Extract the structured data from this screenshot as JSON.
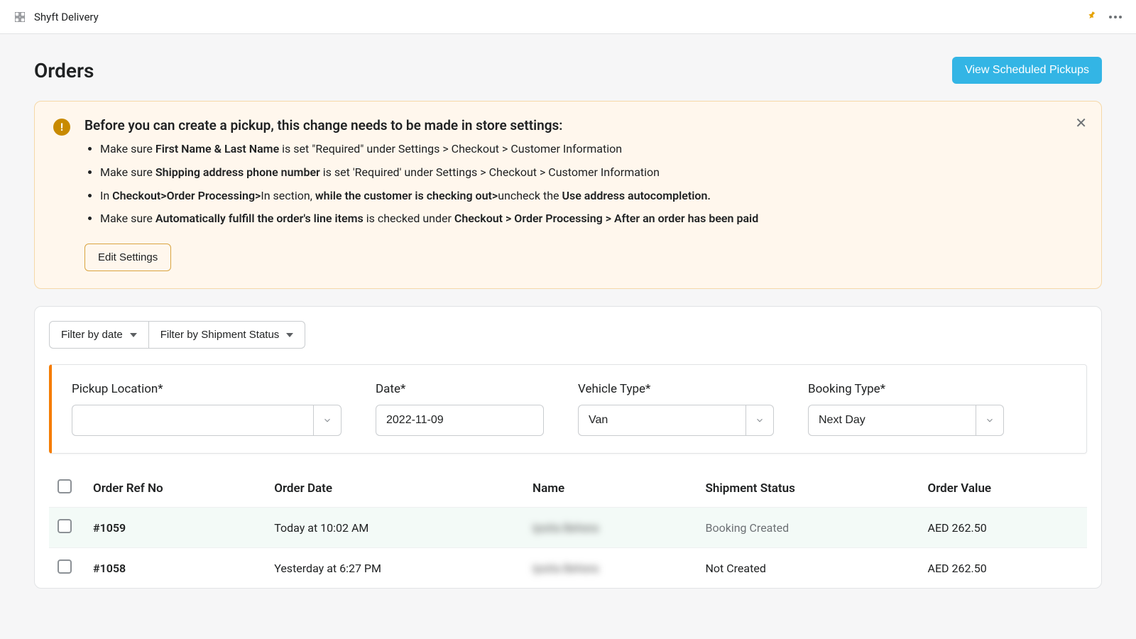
{
  "topbar": {
    "app_name": "Shyft Delivery"
  },
  "page": {
    "title": "Orders",
    "view_pickups_label": "View Scheduled Pickups"
  },
  "banner": {
    "title": "Before you can create a pickup, this change needs to be made in store settings:",
    "items": [
      {
        "pre": "Make sure ",
        "bold1": "First Name & Last Name",
        "mid": " is set \"Required\" under Settings > Checkout > Customer Information",
        "bold2": "",
        "post": ""
      },
      {
        "pre": "Make sure ",
        "bold1": "Shipping address phone number",
        "mid": " is set 'Required' under Settings > Checkout > Customer Information",
        "bold2": "",
        "post": ""
      },
      {
        "pre": "In ",
        "bold1": "Checkout>Order Processing>",
        "mid": "In section, ",
        "bold2": "while the customer is checking out>",
        "post_pre": "uncheck the ",
        "bold3": "Use address autocompletion.",
        "post": ""
      },
      {
        "pre": "Make sure ",
        "bold1": "Automatically fulfill the order's line items",
        "mid": " is checked under ",
        "bold2": "Checkout > Order Processing > After an order has been paid",
        "post": ""
      }
    ],
    "edit_label": "Edit Settings"
  },
  "filters": {
    "by_date": "Filter by date",
    "by_status": "Filter by Shipment Status"
  },
  "form": {
    "pickup_location_label": "Pickup Location*",
    "pickup_location_value": "",
    "date_label": "Date*",
    "date_value": "2022-11-09",
    "vehicle_label": "Vehicle Type*",
    "vehicle_value": "Van",
    "booking_label": "Booking Type*",
    "booking_value": "Next Day"
  },
  "table": {
    "headers": {
      "ref": "Order Ref No",
      "date": "Order Date",
      "name": "Name",
      "status": "Shipment Status",
      "value": "Order Value"
    },
    "rows": [
      {
        "ref": "#1059",
        "date": "Today at 10:02 AM",
        "name": "Ipsita Behera",
        "status": "Booking Created",
        "status_muted": true,
        "value": "AED 262.50",
        "selected_row": true
      },
      {
        "ref": "#1058",
        "date": "Yesterday at 6:27 PM",
        "name": "Ipsita Behera",
        "status": "Not Created",
        "status_muted": false,
        "value": "AED 262.50",
        "selected_row": false
      }
    ]
  }
}
